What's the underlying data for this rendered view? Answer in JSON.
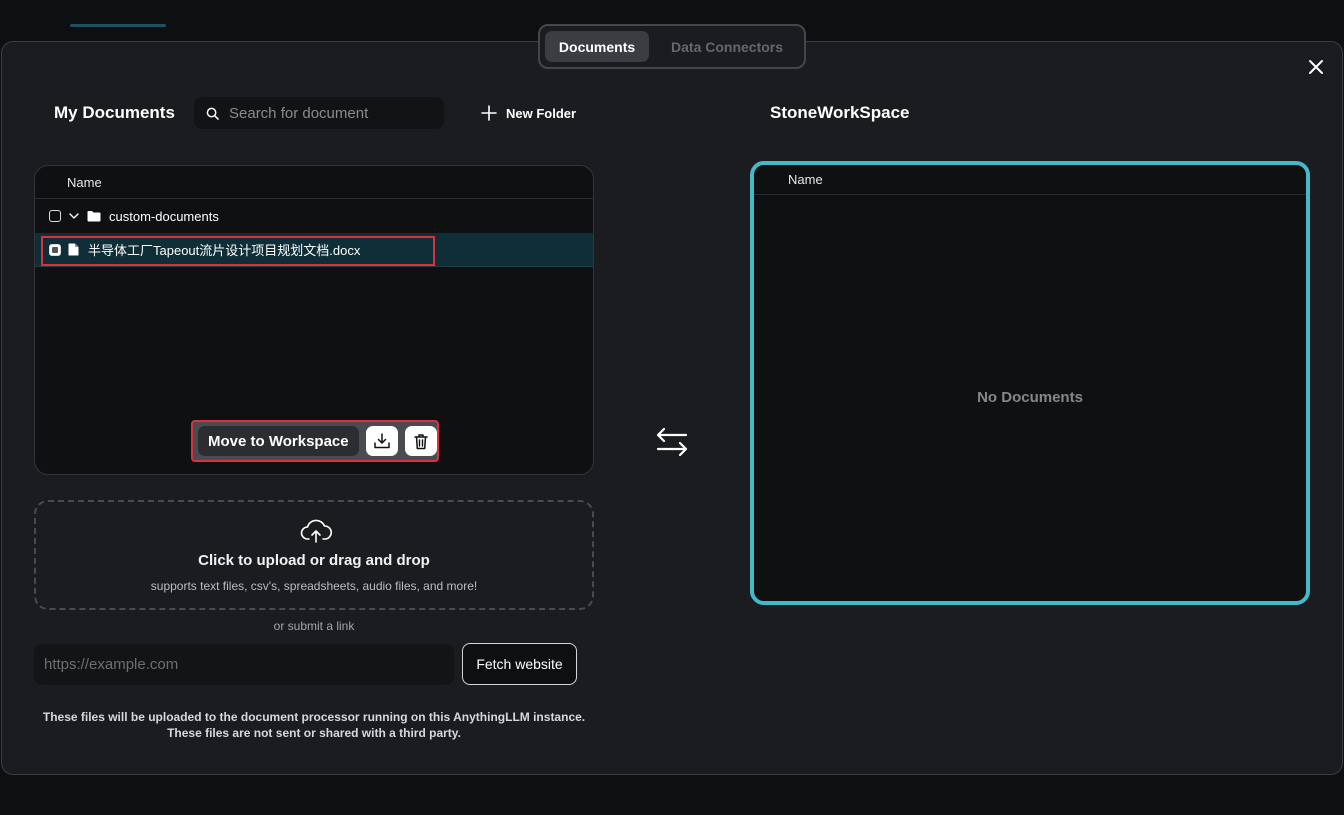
{
  "tabs": {
    "documents": "Documents",
    "data_connectors": "Data Connectors"
  },
  "my_documents": {
    "title": "My Documents",
    "search_placeholder": "Search for document",
    "new_folder_label": "New Folder",
    "column_name": "Name",
    "folder": {
      "name": "custom-documents",
      "expanded": true
    },
    "files": [
      {
        "name": "半导体工厂Tapeout流片设计项目规划文档.docx",
        "selected": true
      }
    ],
    "actions": {
      "move_label": "Move to Workspace",
      "download_icon": "download-icon",
      "delete_icon": "trash-icon"
    }
  },
  "workspace": {
    "title": "StoneWorkSpace",
    "column_name": "Name",
    "empty_text": "No Documents",
    "accent_color": "#46b9c9"
  },
  "upload": {
    "title": "Click to upload or drag and drop",
    "subtitle": "supports text files, csv's, spreadsheets, audio files, and more!",
    "or_link": "or submit a link",
    "url_placeholder": "https://example.com",
    "fetch_label": "Fetch website",
    "footnote_line1": "These files will be uploaded to the document processor running on this AnythingLLM instance.",
    "footnote_line2": "These files are not sent or shared with a third party."
  },
  "colors": {
    "highlight": "#d9313f",
    "selected_row": "#0f2e38"
  }
}
